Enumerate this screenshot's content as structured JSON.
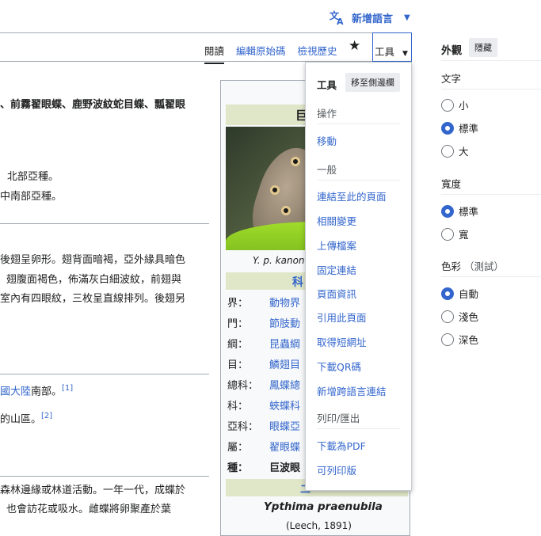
{
  "lang_bar": {
    "label": "新增語言"
  },
  "tabs": [
    {
      "label": "閱讀",
      "active": true
    },
    {
      "label": "編輯原始碼",
      "active": false
    },
    {
      "label": "檢視歷史",
      "active": false
    }
  ],
  "tools_tab": {
    "label": "工具"
  },
  "article": {
    "line1_a": "、前霧翟眼蝶、鹿野波紋蛇目蝶、瓢翟眼",
    "line2": "北部亞種。",
    "line3": "中南部亞種。",
    "line4": "後翅呈卵形。翅背面暗褐，亞外緣具暗色",
    "line5": "翅腹面褐色，佈滿灰白細波紋，前翅與",
    "line6": "室內有四眼紋，三枚呈直線排列。後翅另",
    "line7_link": "國大陸",
    "line7_rest": "南部。",
    "line7_ref": "[1]",
    "line8": "的山區。",
    "line8_ref": "[2]",
    "line9": "森林邊緣或林道活動。一年一代，成蝶於",
    "line10": "也會訪花或吸水。雌蝶將卵聚產於葉"
  },
  "infobox": {
    "title": "巨",
    "caption": "Y. p. kanon",
    "class_header": "科",
    "rows": [
      {
        "k": "界：",
        "v": "動物界"
      },
      {
        "k": "門：",
        "v": "節肢動"
      },
      {
        "k": "綱：",
        "v": "昆蟲綱"
      },
      {
        "k": "目：",
        "v": "鱗翅目"
      },
      {
        "k": "總科：",
        "v": "鳳蝶總"
      },
      {
        "k": "科：",
        "v": "蛺蝶科"
      },
      {
        "k": "亞科：",
        "v": "眼蝶亞"
      },
      {
        "k": "屬：",
        "v": "翟眼蝶"
      },
      {
        "k": "種：",
        "v": "巨波眼"
      }
    ],
    "binomial_header": "二",
    "scientific_name": "Ypthima praenubila",
    "author": "(Leech, 1891)"
  },
  "tools_menu": {
    "title": "工具",
    "move_label": "移至側邊欄",
    "sections": [
      {
        "heading": "操作",
        "items": [
          "移動"
        ]
      },
      {
        "heading": "一般",
        "items": [
          "連結至此的頁面",
          "相關變更",
          "上傳檔案",
          "固定連結",
          "頁面資訊",
          "引用此頁面",
          "取得短網址",
          "下載QR碼",
          "新增跨語言連結"
        ]
      },
      {
        "heading": "列印/匯出",
        "items": [
          "下載為PDF",
          "可列印版"
        ]
      }
    ]
  },
  "appearance": {
    "title": "外觀",
    "hide_label": "隱藏",
    "text_heading": "文字",
    "text_options": [
      "小",
      "標準",
      "大"
    ],
    "width_heading": "寬度",
    "width_options": [
      "標準",
      "寬"
    ],
    "color_heading": "色彩",
    "color_note": "（測試）",
    "color_options": [
      "自動",
      "淺色",
      "深色"
    ]
  }
}
